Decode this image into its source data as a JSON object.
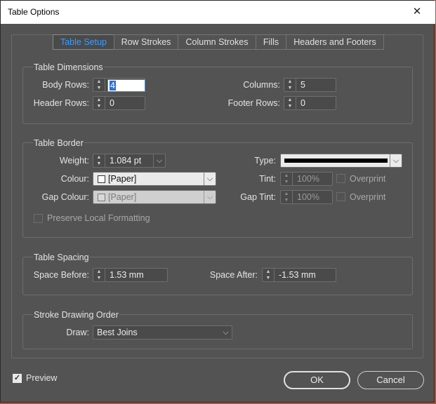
{
  "window": {
    "title": "Table Options",
    "close_glyph": "✕"
  },
  "tabs": [
    {
      "label": "Table Setup",
      "active": true
    },
    {
      "label": "Row Strokes",
      "active": false
    },
    {
      "label": "Column Strokes",
      "active": false
    },
    {
      "label": "Fills",
      "active": false
    },
    {
      "label": "Headers and Footers",
      "active": false
    }
  ],
  "table_dimensions": {
    "title": "Table Dimensions",
    "body_rows": {
      "label": "Body Rows:",
      "value": "4"
    },
    "header_rows": {
      "label": "Header Rows:",
      "value": "0"
    },
    "columns": {
      "label": "Columns:",
      "value": "5"
    },
    "footer_rows": {
      "label": "Footer Rows:",
      "value": "0"
    }
  },
  "table_border": {
    "title": "Table Border",
    "weight": {
      "label": "Weight:",
      "value": "1.084 pt"
    },
    "type": {
      "label": "Type:"
    },
    "colour": {
      "label": "Colour:",
      "value": "[Paper]"
    },
    "tint": {
      "label": "Tint:",
      "value": "100%"
    },
    "gap_colour": {
      "label": "Gap Colour:",
      "value": "[Paper]"
    },
    "gap_tint": {
      "label": "Gap Tint:",
      "value": "100%"
    },
    "overprint_label": "Overprint",
    "gap_overprint_label": "Overprint",
    "preserve_local_formatting": "Preserve Local Formatting"
  },
  "table_spacing": {
    "title": "Table Spacing",
    "space_before": {
      "label": "Space Before:",
      "value": "1.53 mm"
    },
    "space_after": {
      "label": "Space After:",
      "value": "-1.53 mm"
    }
  },
  "stroke_drawing_order": {
    "title": "Stroke Drawing Order",
    "draw": {
      "label": "Draw:",
      "value": "Best Joins"
    }
  },
  "footer": {
    "preview_label": "Preview",
    "preview_checked": true,
    "ok_label": "OK",
    "cancel_label": "Cancel"
  },
  "glyphs": {
    "spin_up": "▲",
    "spin_down": "▼",
    "dropdown": "⌵",
    "check": "✓"
  },
  "colors": {
    "accent": "#3d9bff",
    "dialog_bg": "#535353",
    "border_type_line": "#000000"
  }
}
